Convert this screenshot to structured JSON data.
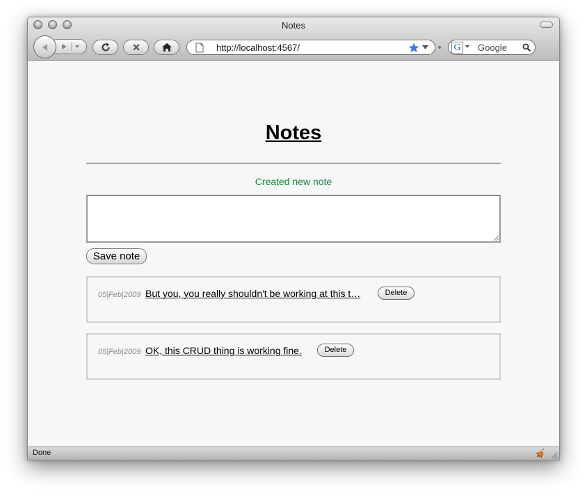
{
  "window": {
    "title": "Notes"
  },
  "toolbar": {
    "url": "http://localhost:4567/",
    "search_placeholder": "Google",
    "search_engine_letter": "G"
  },
  "page": {
    "heading": "Notes",
    "flash": "Created new note",
    "textarea_value": "",
    "save_label": "Save note",
    "notes": [
      {
        "date": "05|Feb|2009",
        "text": "But you, you really shouldn't be working at this t…",
        "delete_label": "Delete"
      },
      {
        "date": "05|Feb|2009",
        "text": "OK, this CRUD thing is working fine.",
        "delete_label": "Delete"
      }
    ]
  },
  "status": {
    "text": "Done"
  },
  "colors": {
    "flash": "#118a3a",
    "bookmark_star": "#3a7bd5"
  }
}
